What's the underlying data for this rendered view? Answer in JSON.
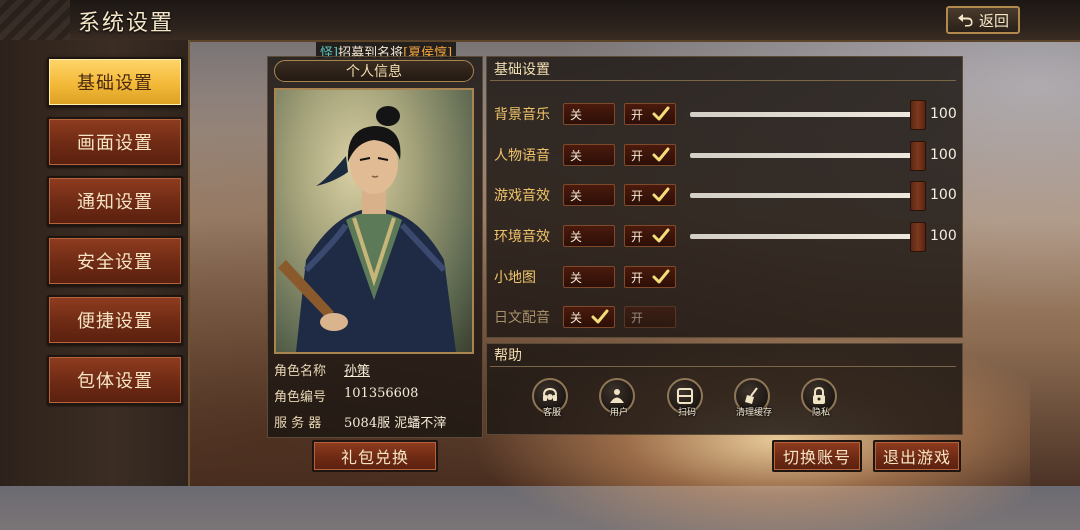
{
  "header": {
    "title": "系统设置",
    "back_label": "返回"
  },
  "sidebar": {
    "items": [
      {
        "label": "基础设置",
        "active": true
      },
      {
        "label": "画面设置",
        "active": false
      },
      {
        "label": "通知设置",
        "active": false
      },
      {
        "label": "安全设置",
        "active": false
      },
      {
        "label": "便捷设置",
        "active": false
      },
      {
        "label": "包体设置",
        "active": false
      }
    ]
  },
  "marquee": {
    "prefix": "怪]",
    "text": "招募到名将",
    "highlight": "[夏侯惇]"
  },
  "profile": {
    "title": "个人信息",
    "rows": [
      {
        "key": "角色名称",
        "value": "孙策"
      },
      {
        "key": "角色编号",
        "value": "101356608"
      },
      {
        "key": "服 务 器",
        "value": "5084服 泥蟠不滓"
      }
    ],
    "gift_label": "礼包兑换"
  },
  "settings": {
    "title": "基础设置",
    "off_label": "关",
    "on_label": "开",
    "rows": [
      {
        "label": "背景音乐",
        "on": true,
        "volume": 100
      },
      {
        "label": "人物语音",
        "on": true,
        "volume": 100
      },
      {
        "label": "游戏音效",
        "on": true,
        "volume": 100
      },
      {
        "label": "环境音效",
        "on": true,
        "volume": 100
      },
      {
        "label": "小地图",
        "on": true
      },
      {
        "label": "日文配音",
        "on": false
      }
    ]
  },
  "help": {
    "title": "帮助",
    "items": [
      {
        "label": "客服",
        "icon": "customer-service-icon"
      },
      {
        "label": "用户",
        "icon": "user-icon"
      },
      {
        "label": "扫码",
        "icon": "scan-icon"
      },
      {
        "label": "清理缓存",
        "icon": "broom-icon"
      },
      {
        "label": "隐私",
        "icon": "lock-icon"
      }
    ]
  },
  "actions": {
    "switch_account": "切换账号",
    "exit_game": "退出游戏"
  },
  "colors": {
    "accent_gold": "#f3b938",
    "button_red": "#6e2a14",
    "check": "#f3dc7a"
  }
}
